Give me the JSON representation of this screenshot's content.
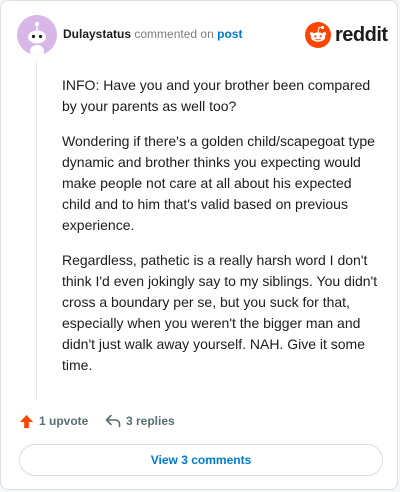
{
  "comment": {
    "username": "Dulaystatus",
    "action_text": "commented on",
    "post_link": "post",
    "paragraphs": [
      "INFO: Have you and your brother been compared by your parents as well too?",
      "Wondering if there's a golden child/scapegoat type dynamic and brother thinks you expecting would make people not care at all about his expected child and to him that's valid based on previous experience.",
      "Regardless, pathetic is a really harsh word I don't think I'd even jokingly say to my siblings. You didn't cross a boundary per se, but you suck for that, especially when you weren't the bigger man and didn't just walk away yourself. NAH. Give it some time."
    ]
  },
  "brand": {
    "name": "reddit",
    "color": "#ff4500"
  },
  "actions": {
    "upvote_label": "1 upvote",
    "replies_label": "3 replies"
  },
  "view_button": {
    "label": "View 3 comments"
  },
  "colors": {
    "link": "#0079d3",
    "upvote": "#ff4500",
    "avatar_bg": "#d9b6e8"
  }
}
